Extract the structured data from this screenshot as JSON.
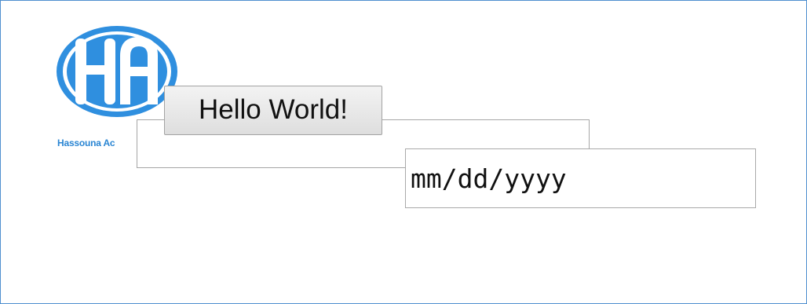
{
  "logo": {
    "name": "logo",
    "caption": "Hassouna Ac",
    "brand_color": "#2f8fdf"
  },
  "hello_button": {
    "label": "Hello World!"
  },
  "date_input": {
    "placeholder": "mm/dd/yyyy",
    "value": ""
  },
  "colors": {
    "frame_border": "#4f90cf",
    "input_border": "#a9a9a9"
  }
}
